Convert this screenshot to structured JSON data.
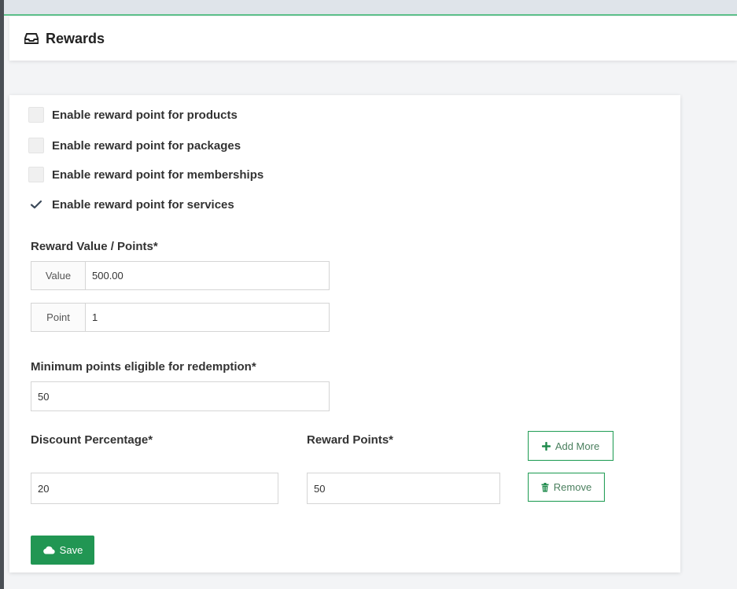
{
  "header": {
    "title": "Rewards",
    "icon": "inbox-icon"
  },
  "settings": {
    "checkboxes": [
      {
        "label": "Enable reward point for products",
        "checked": false
      },
      {
        "label": "Enable reward point for packages",
        "checked": false
      },
      {
        "label": "Enable reward point for memberships",
        "checked": false
      },
      {
        "label": "Enable reward point for services",
        "checked": true
      }
    ]
  },
  "reward_value": {
    "label": "Reward Value / Points*",
    "value_addon": "Value",
    "value": "500.00",
    "point_addon": "Point",
    "point": "1"
  },
  "min_points": {
    "label": "Minimum points eligible for redemption*",
    "value": "50"
  },
  "discount_table": {
    "discount_label": "Discount Percentage*",
    "reward_points_label": "Reward Points*",
    "add_more_label": "Add More",
    "remove_label": "Remove",
    "rows": [
      {
        "discount": "20",
        "points": "50"
      }
    ]
  },
  "actions": {
    "save_label": "Save"
  },
  "colors": {
    "accent": "#219653",
    "accent_border": "#28a05a",
    "top_strip_border": "#5cc08a"
  }
}
